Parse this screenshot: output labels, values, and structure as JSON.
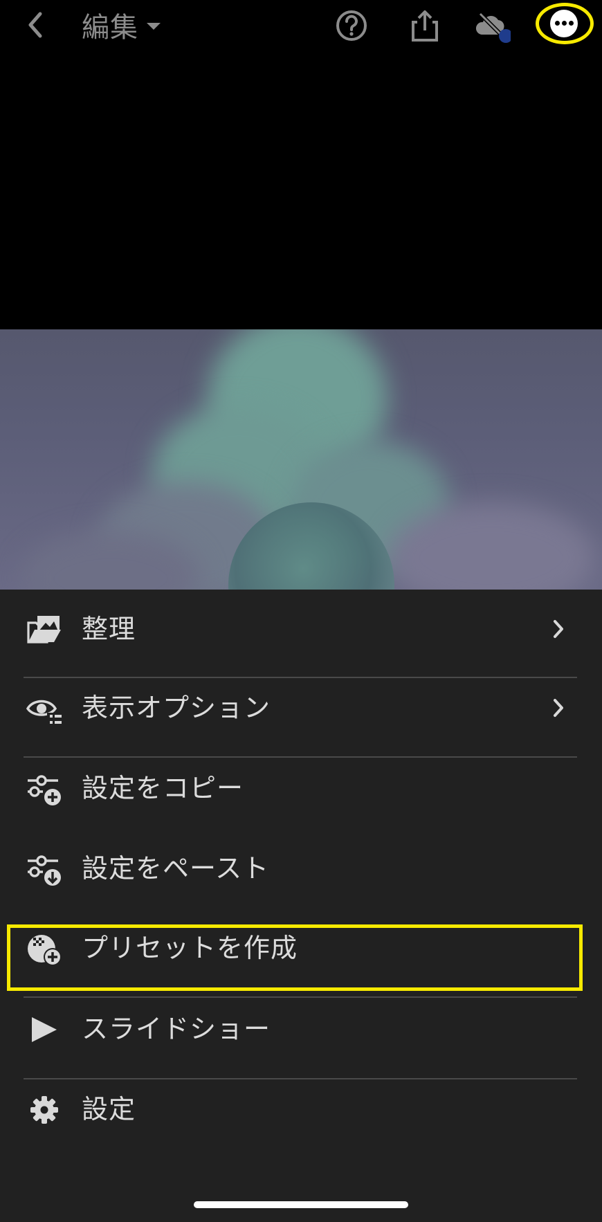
{
  "header": {
    "title": "編集",
    "icons": [
      "back-chevron-icon",
      "help-icon",
      "share-icon",
      "cloud-sync-icon",
      "more-options-icon"
    ]
  },
  "menu": {
    "items": [
      {
        "label": "整理",
        "icon": "organize-folder-icon",
        "has_chevron": true
      },
      {
        "label": "表示オプション",
        "icon": "view-options-icon",
        "has_chevron": true
      },
      {
        "label": "設定をコピー",
        "icon": "copy-settings-icon",
        "has_chevron": false
      },
      {
        "label": "設定をペースト",
        "icon": "paste-settings-icon",
        "has_chevron": false
      },
      {
        "label": "プリセットを作成",
        "icon": "create-preset-icon",
        "has_chevron": false
      },
      {
        "label": "スライドショー",
        "icon": "play-icon",
        "has_chevron": false
      },
      {
        "label": "設定",
        "icon": "gear-icon",
        "has_chevron": false
      }
    ]
  },
  "colors": {
    "highlight": "#f7ea00",
    "menu_bg": "#212121",
    "text": "#dcdcdc"
  }
}
